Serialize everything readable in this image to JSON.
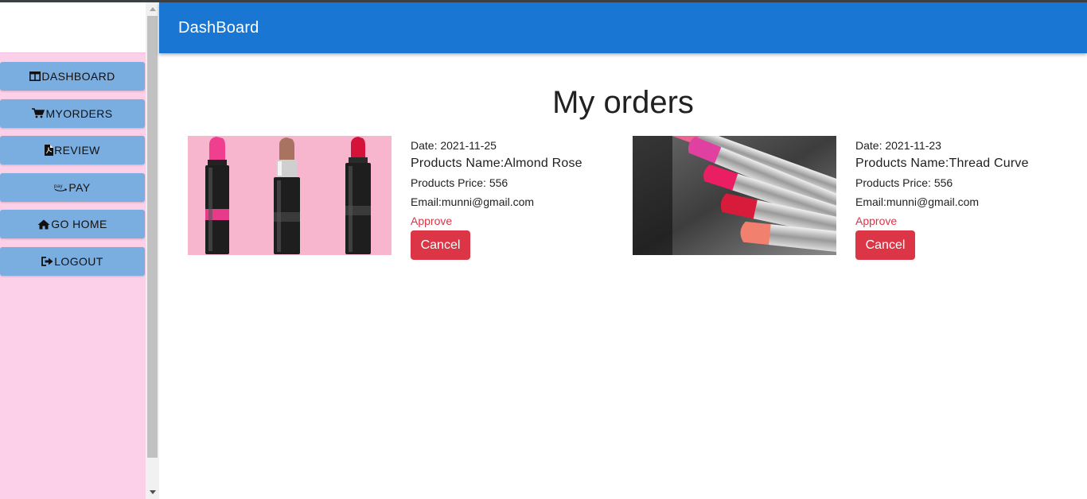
{
  "appbar": {
    "title": "DashBoard"
  },
  "sidebar": {
    "items": [
      {
        "label": "DASHBOARD",
        "icon": "columns-icon"
      },
      {
        "label": "MYORDERS",
        "icon": "cart-icon"
      },
      {
        "label": "REVIEW",
        "icon": "file-pdf-icon"
      },
      {
        "label": "PAY",
        "icon": "amazon-pay-icon"
      },
      {
        "label": "GO HOME",
        "icon": "home-icon"
      },
      {
        "label": "LOGOUT",
        "icon": "sign-out-icon"
      }
    ]
  },
  "main": {
    "title": "My orders",
    "orders": [
      {
        "date": "Date: 2021-11-25",
        "name": "Products Name:Almond Rose",
        "price": "Products Price: 556",
        "email": "Email:munni@gmail.com",
        "status": "Approve",
        "cancel_label": "Cancel",
        "image": "avon-lipsticks-image"
      },
      {
        "date": "Date: 2021-11-23",
        "name": "Products Name:Thread Curve",
        "price": "Products Price: 556",
        "email": "Email:munni@gmail.com",
        "status": "Approve",
        "cancel_label": "Cancel",
        "image": "pink-lipsticks-image"
      }
    ]
  },
  "colors": {
    "appbar": "#1976d2",
    "sidebar_bg": "#fcd0e8",
    "nav_button": "#7aaee0",
    "status": "#dc3545",
    "cancel_button": "#dc3545"
  }
}
